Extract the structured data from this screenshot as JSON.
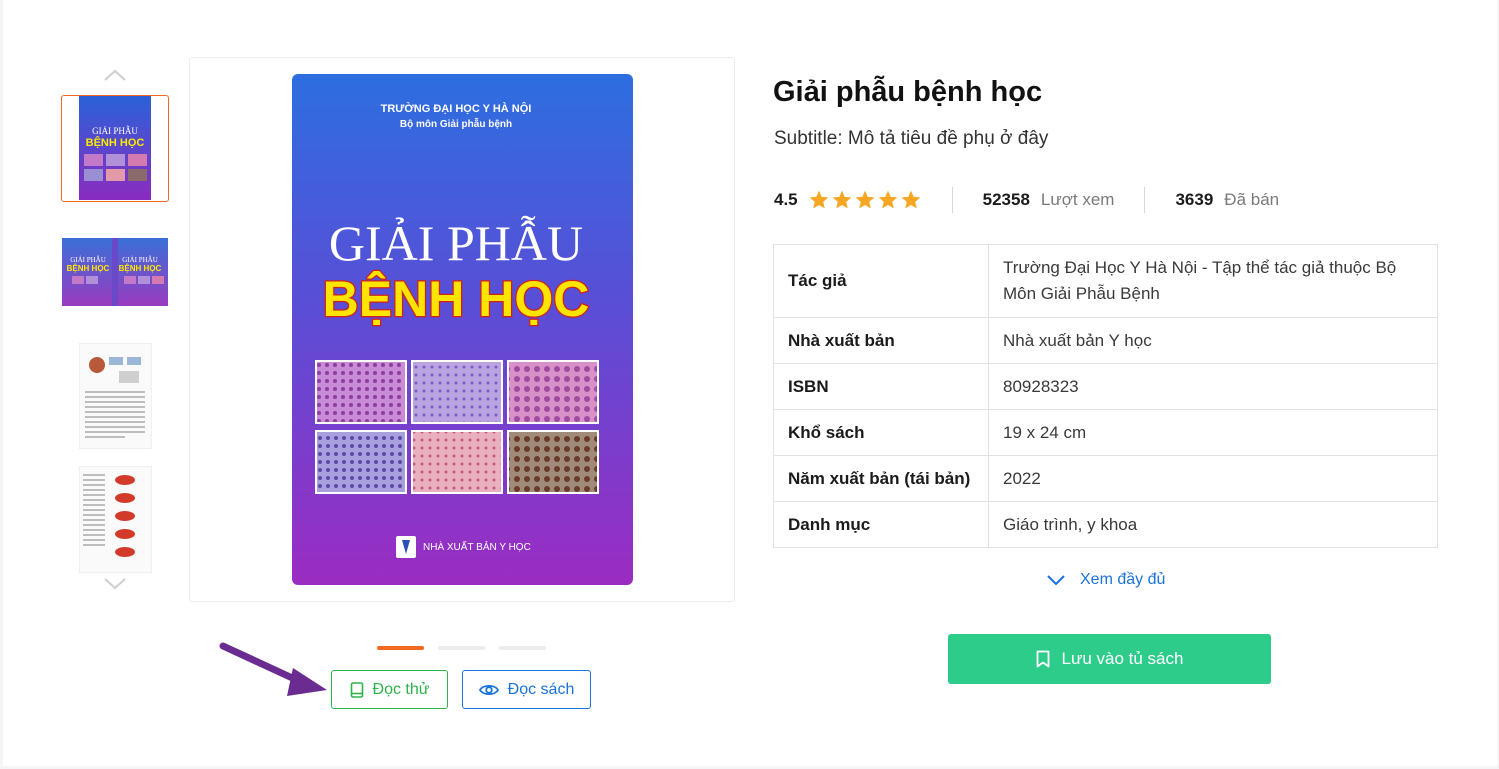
{
  "book": {
    "title": "Giải phẫu bệnh học",
    "subtitle": "Subtitle: Mô tả tiêu đề phụ ở đây",
    "rating": "4.5",
    "star_count": 5,
    "views_count": "52358",
    "views_label": "Lượt xem",
    "sold_count": "3639",
    "sold_label": "Đã bán"
  },
  "cover": {
    "school": "TRƯỜNG ĐẠI HỌC Y HÀ NỘI",
    "department": "Bộ môn Giải phẫu bệnh",
    "title_line1": "GIẢI PHẪU",
    "title_line2": "BỆNH HỌC",
    "publisher": "NHÀ XUẤT BẢN Y HỌC"
  },
  "details": [
    {
      "label": "Tác giả",
      "value": "Trường Đại Học Y Hà Nội - Tập thể tác giả thuộc Bộ Môn Giải Phẫu Bệnh"
    },
    {
      "label": "Nhà xuất bản",
      "value": "Nhà xuất bản Y học"
    },
    {
      "label": "ISBN",
      "value": "80928323"
    },
    {
      "label": "Khổ sách",
      "value": "19 x 24 cm"
    },
    {
      "label": "Năm xuất bản (tái bản)",
      "value": "2022"
    },
    {
      "label": "Danh mục",
      "value": "Giáo trình, y khoa"
    }
  ],
  "actions": {
    "see_more": "Xem đầy đủ",
    "save": "Lưu vào tủ sách",
    "try_read": "Đọc thử",
    "read": "Đọc sách"
  },
  "colors": {
    "accent_orange": "#f26a21",
    "green": "#2eb24b",
    "blue": "#1a73d9",
    "save_green": "#2ecc8a",
    "star": "#f5a623",
    "annotation_arrow": "#6a2c91"
  },
  "gallery": {
    "thumbnail_count": 4,
    "active_thumbnail": 1,
    "slide_count": 3,
    "active_slide": 1
  }
}
